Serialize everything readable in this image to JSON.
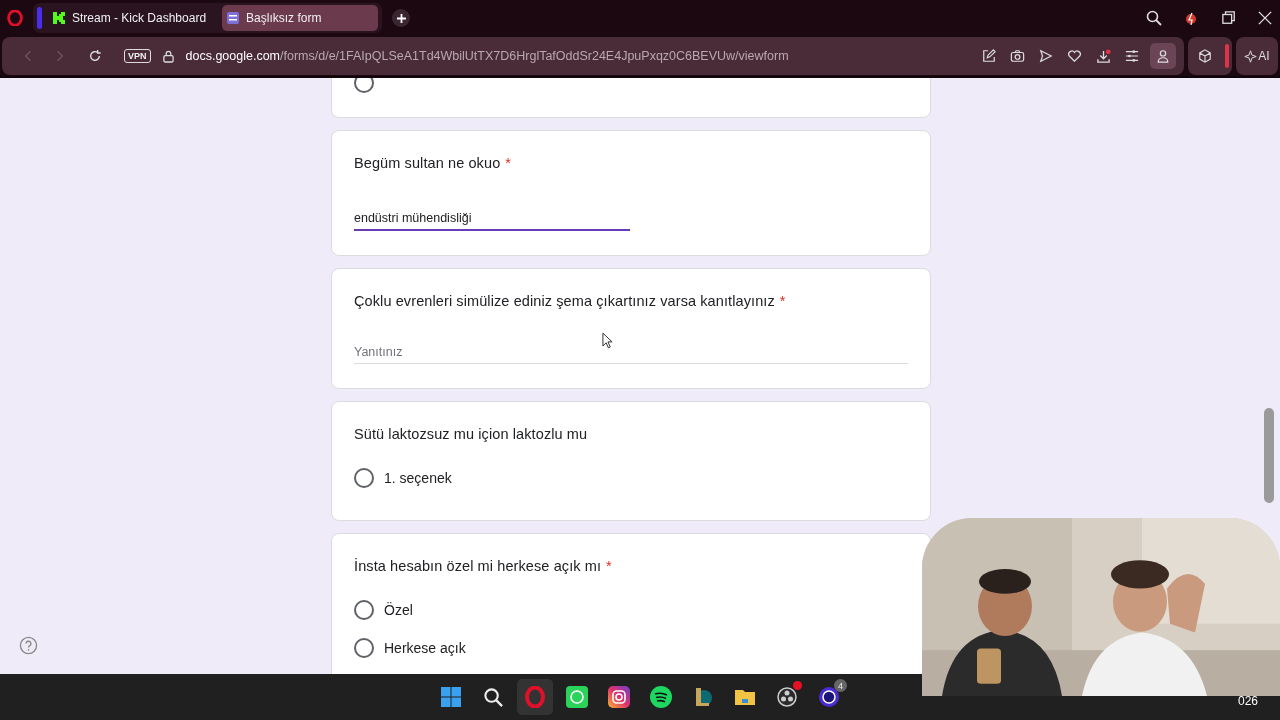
{
  "browser": {
    "tabs": [
      {
        "title": "Stream - Kick Dashboard",
        "selected": false
      },
      {
        "title": "Başlıksız form",
        "selected": true
      }
    ],
    "vpn_label": "VPN",
    "url_host": "docs.google.com",
    "url_path": "/forms/d/e/1FAIpQLSeA1Td4WbilUtTX7D6HrglTafOddSr24E4JpuPxqz0C6BEVUw/viewform",
    "ai_label": "AI"
  },
  "form": {
    "required_mark": "*",
    "questions": [
      {
        "kind": "choice",
        "options": [
          {
            "selected": false
          }
        ]
      },
      {
        "kind": "text",
        "title": "Begüm sultan ne okuo",
        "required": true,
        "value": "endüstri mühendisliği"
      },
      {
        "kind": "text",
        "title": "Çoklu evrenleri simülize ediniz şema çıkartınız varsa kanıtlayınız",
        "required": true,
        "placeholder": "Yanıtınız"
      },
      {
        "kind": "choice",
        "title": "Sütü laktozsuz mu içion laktozlu mu",
        "required": false,
        "options": [
          {
            "label": "1. seçenek",
            "selected": false
          }
        ]
      },
      {
        "kind": "choice",
        "title": "İnsta hesabın özel mi herkese açık mı",
        "required": true,
        "options": [
          {
            "label": "Özel",
            "selected": false
          },
          {
            "label": "Herkese açık",
            "selected": false
          }
        ]
      }
    ]
  },
  "taskbar": {
    "apps": [
      {
        "kind": "start",
        "active": false
      },
      {
        "kind": "search",
        "active": false
      },
      {
        "kind": "opera",
        "active": true
      },
      {
        "kind": "chat",
        "active": false
      },
      {
        "kind": "camera",
        "active": false
      },
      {
        "kind": "music",
        "active": false
      },
      {
        "kind": "game",
        "active": false
      },
      {
        "kind": "folder",
        "active": false
      },
      {
        "kind": "recorder",
        "active": false,
        "notify": true
      },
      {
        "kind": "messenger",
        "active": false,
        "badge": "4"
      }
    ],
    "clock": "026"
  }
}
